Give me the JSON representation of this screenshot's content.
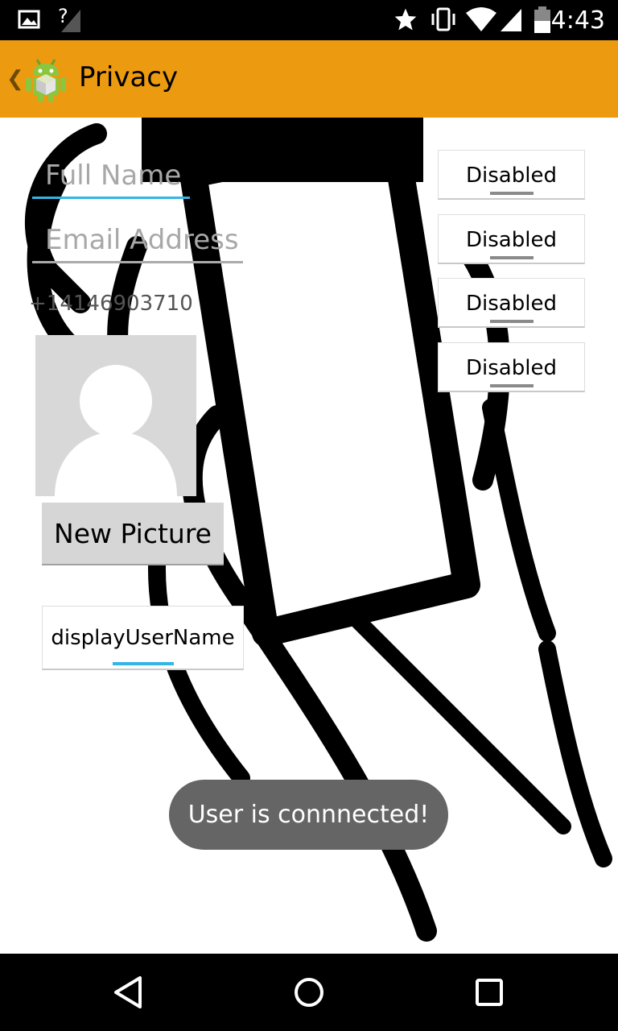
{
  "status_bar": {
    "time": "4:43",
    "icons": [
      "image-icon",
      "signal-unknown-icon",
      "star-icon",
      "vibrate-icon",
      "wifi-icon",
      "cell-signal-icon",
      "battery-icon"
    ],
    "signal_question": "?"
  },
  "action_bar": {
    "title": "Privacy",
    "up_caret": "❮",
    "background": "#ec9a10"
  },
  "profile": {
    "full_name_placeholder": "Full Name",
    "email_placeholder": "Email Address",
    "phone": "+14146903710",
    "new_picture_label": "New Picture",
    "display_user_name_label": "displayUserName"
  },
  "toggles": [
    {
      "label": "Disabled"
    },
    {
      "label": "Disabled"
    },
    {
      "label": "Disabled"
    },
    {
      "label": "Disabled"
    }
  ],
  "toast": {
    "message": "User is connnected!"
  },
  "colors": {
    "accent": "#33b5e5",
    "toast_bg": "#656565"
  }
}
